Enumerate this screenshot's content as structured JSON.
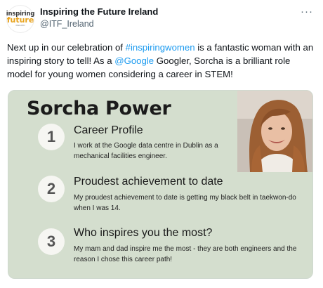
{
  "account": {
    "display_name": "Inspiring the Future Ireland",
    "handle": "@ITF_Ireland",
    "logo_top": "inspiring",
    "logo_bottom": "future",
    "logo_sub": "IRELAND"
  },
  "tweet": {
    "text_1": "Next up in our celebration of ",
    "hashtag": "#inspiringwomen",
    "text_2": " is a fantastic woman with an inspiring story to tell! As a ",
    "mention": "@Google",
    "text_3": " Googler, Sorcha is a brilliant role model for young women considering a career in STEM!"
  },
  "more_icon": "more-horizontal-icon",
  "card": {
    "title": "Sorcha Power",
    "sections": [
      {
        "number": "1",
        "title": "Career Profile",
        "body": "I work at the Google data centre in Dublin as a mechanical facilities engineer."
      },
      {
        "number": "2",
        "title": "Proudest achievement to date",
        "body": "My proudest achievement to date is getting my black belt in taekwon-do when I was 14."
      },
      {
        "number": "3",
        "title": "Who inspires you the most?",
        "body": "My mam and dad inspire me the most - they are both engineers and the reason I chose this career path!"
      }
    ]
  },
  "colors": {
    "link": "#1d9bf0",
    "card_background": "#d4dece",
    "logo_orange": "#e8a21a"
  }
}
